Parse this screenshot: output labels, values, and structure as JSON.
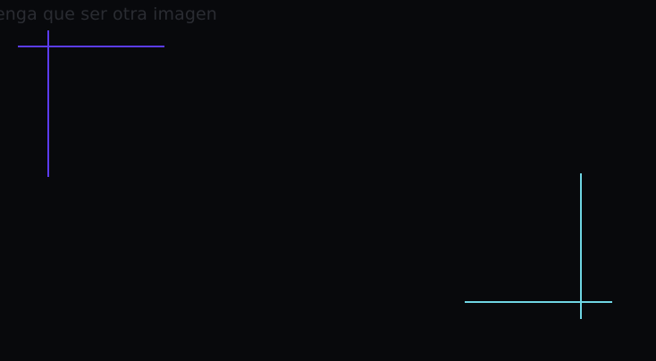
{
  "caption": {
    "text": "enga que ser otra imagen",
    "color": "#2a2c32"
  },
  "crosshairs": [
    {
      "name": "corner-crosshair-top-left",
      "color": "#5b3cf0"
    },
    {
      "name": "corner-crosshair-bottom-right",
      "color": "#6fd6e4"
    }
  ],
  "background": "#08090c"
}
